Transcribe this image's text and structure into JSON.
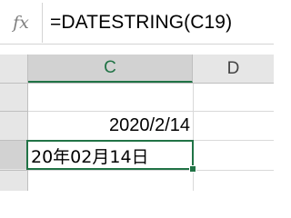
{
  "formula_bar": {
    "fx_label": "fx",
    "formula": "=DATESTRING(C19)"
  },
  "grid": {
    "columns": [
      "C",
      "D"
    ],
    "selected_column": "C",
    "cells": {
      "c19": "2020/2/14",
      "c20": "20年02月14日"
    }
  },
  "colors": {
    "selection_accent": "#217346",
    "header_bg": "#e6e6e6",
    "selected_header_bg": "#d2d2d2",
    "gridline": "#d9d9d9"
  },
  "icons": [
    "insert-function-icon",
    "fill-handle"
  ]
}
